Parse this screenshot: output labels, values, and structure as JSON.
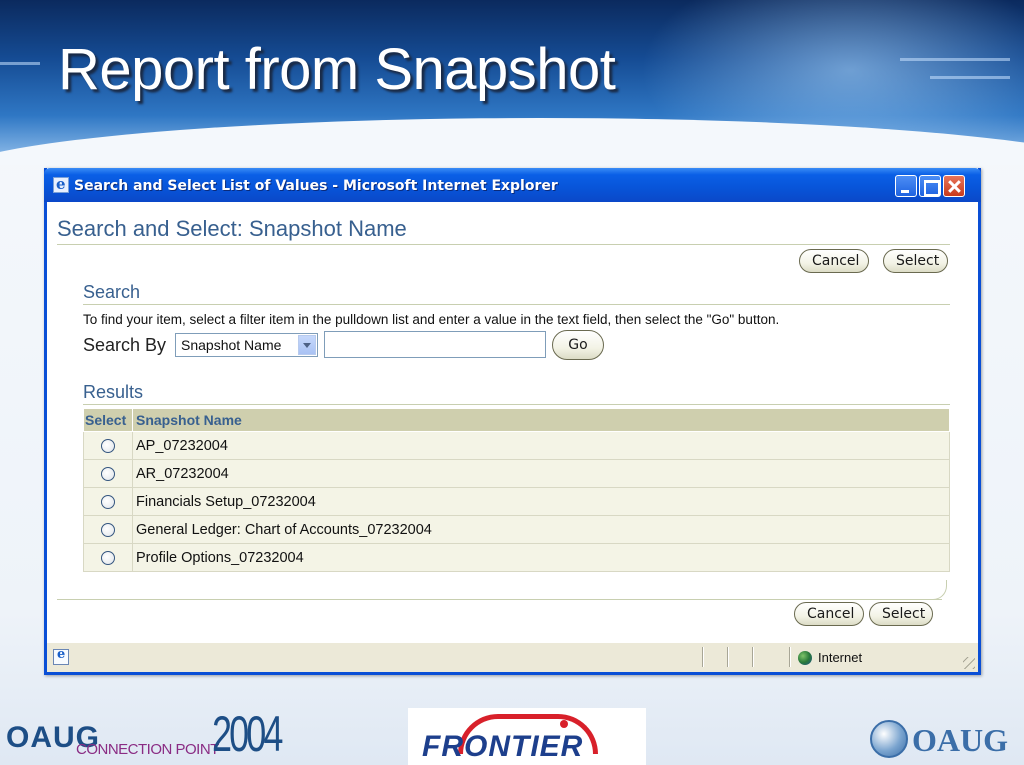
{
  "slide": {
    "title": "Report from Snapshot"
  },
  "window": {
    "title": "Search and Select List of Values - Microsoft Internet Explorer",
    "title_bar_color": "#0854d8"
  },
  "page": {
    "heading": "Search and Select: Snapshot Name",
    "top_buttons": {
      "cancel": "Cancel",
      "select": "Select"
    },
    "search": {
      "heading": "Search",
      "instructions": "To find your item, select a filter item in the pulldown list and enter a value in the text field, then select the \"Go\" button.",
      "search_by_label": "Search By",
      "filter_selected": "Snapshot Name",
      "search_value": "",
      "go_button": "Go"
    },
    "results": {
      "heading": "Results",
      "columns": [
        "Select",
        "Snapshot Name"
      ],
      "rows": [
        {
          "name": "AP_07232004"
        },
        {
          "name": "AR_07232004"
        },
        {
          "name": "Financials Setup_07232004"
        },
        {
          "name": "General Ledger: Chart of Accounts_07232004"
        },
        {
          "name": "Profile Options_07232004"
        }
      ]
    },
    "bottom_buttons": {
      "cancel": "Cancel",
      "select": "Select"
    }
  },
  "status_bar": {
    "zone": "Internet",
    "zone_icon": "globe-icon"
  },
  "footer": {
    "left_logo": {
      "brand": "OAUG",
      "tagline": "CONNECTION POINT",
      "year": "2004"
    },
    "center_logo": {
      "brand": "FRONTIER"
    },
    "right_logo": {
      "brand": "OAUG"
    }
  },
  "colors": {
    "heading_blue": "#38608f",
    "table_header": "#cfcfae",
    "table_row": "#f4f4e6"
  }
}
